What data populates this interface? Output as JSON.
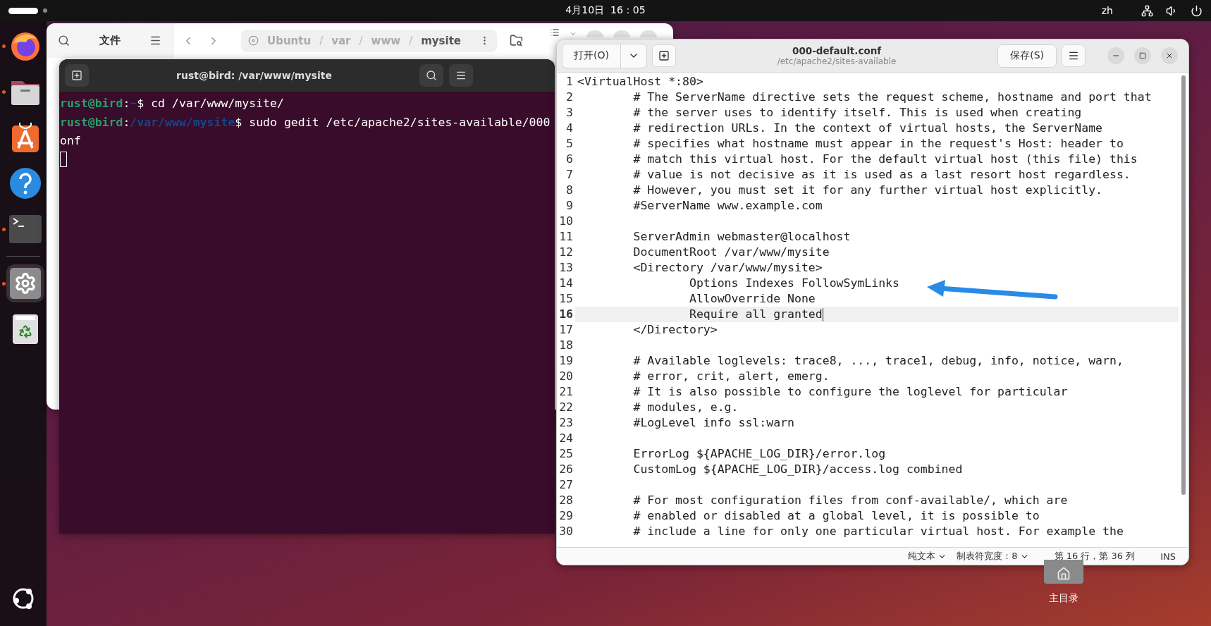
{
  "top_bar": {
    "clock": "4月10日  16：05",
    "language": "zh"
  },
  "dock": {
    "items": [
      {
        "kind": "browser",
        "running": true,
        "selected": false
      },
      {
        "kind": "files",
        "running": true,
        "selected": false
      },
      {
        "kind": "store",
        "running": false,
        "selected": false
      },
      {
        "kind": "help",
        "running": false,
        "selected": false
      },
      {
        "kind": "terminal",
        "running": true,
        "selected": false
      },
      {
        "kind": "separator"
      },
      {
        "kind": "settings",
        "running": true,
        "selected": true
      },
      {
        "kind": "trash",
        "running": false,
        "selected": false
      }
    ]
  },
  "files_window": {
    "sidebar_title": "文件",
    "path_separator": "/",
    "path": [
      "Ubuntu",
      "var",
      "www",
      "mysite"
    ]
  },
  "terminal": {
    "title": "rust@bird: /var/www/mysite",
    "lines": [
      {
        "kind": "prompt",
        "user": "rust@bird",
        "separator": ":",
        "path": "~",
        "symbol": "$",
        "command": " cd /var/www/mysite/"
      },
      {
        "kind": "prompt",
        "user": "rust@bird",
        "separator": ":",
        "path": "/var/www/mysite",
        "symbol": "$",
        "command": " sudo gedit /etc/apache2/sites-available/000"
      },
      {
        "kind": "output",
        "text": "onf"
      }
    ]
  },
  "editor": {
    "open_button": "打开(O)",
    "title": "000-default.conf",
    "subtitle": "/etc/apache2/sites-available",
    "save_button": "保存(S)",
    "lines": [
      {
        "number": "1",
        "text": "<VirtualHost *:80>",
        "current": false
      },
      {
        "number": "2",
        "text": "\t# The ServerName directive sets the request scheme, hostname and port that",
        "current": false
      },
      {
        "number": "3",
        "text": "\t# the server uses to identify itself. This is used when creating",
        "current": false
      },
      {
        "number": "4",
        "text": "\t# redirection URLs. In the context of virtual hosts, the ServerName",
        "current": false
      },
      {
        "number": "5",
        "text": "\t# specifies what hostname must appear in the request's Host: header to",
        "current": false
      },
      {
        "number": "6",
        "text": "\t# match this virtual host. For the default virtual host (this file) this",
        "current": false
      },
      {
        "number": "7",
        "text": "\t# value is not decisive as it is used as a last resort host regardless.",
        "current": false
      },
      {
        "number": "8",
        "text": "\t# However, you must set it for any further virtual host explicitly.",
        "current": false
      },
      {
        "number": "9",
        "text": "\t#ServerName www.example.com",
        "current": false
      },
      {
        "number": "10",
        "current": false
      },
      {
        "number": "11",
        "text": "\tServerAdmin webmaster@localhost",
        "current": false
      },
      {
        "number": "12",
        "text": "\tDocumentRoot /var/www/mysite",
        "current": false
      },
      {
        "number": "13",
        "text": "\t<Directory /var/www/mysite>",
        "current": false
      },
      {
        "number": "14",
        "text": "\t\tOptions Indexes FollowSymLinks",
        "current": false
      },
      {
        "number": "15",
        "text": "\t\tAllowOverride None",
        "current": false
      },
      {
        "number": "16",
        "text": "\t\tRequire all granted",
        "current": true
      },
      {
        "number": "17",
        "text": "\t</Directory>",
        "current": false
      },
      {
        "number": "18",
        "current": false
      },
      {
        "number": "19",
        "text": "\t# Available loglevels: trace8, ..., trace1, debug, info, notice, warn,",
        "current": false
      },
      {
        "number": "20",
        "text": "\t# error, crit, alert, emerg.",
        "current": false
      },
      {
        "number": "21",
        "text": "\t# It is also possible to configure the loglevel for particular",
        "current": false
      },
      {
        "number": "22",
        "text": "\t# modules, e.g.",
        "current": false
      },
      {
        "number": "23",
        "text": "\t#LogLevel info ssl:warn",
        "current": false
      },
      {
        "number": "24",
        "current": false
      },
      {
        "number": "25",
        "text": "\tErrorLog ${APACHE_LOG_DIR}/error.log",
        "current": false
      },
      {
        "number": "26",
        "text": "\tCustomLog ${APACHE_LOG_DIR}/access.log combined",
        "current": false
      },
      {
        "number": "27",
        "current": false
      },
      {
        "number": "28",
        "text": "\t# For most configuration files from conf-available/, which are",
        "current": false
      },
      {
        "number": "29",
        "text": "\t# enabled or disabled at a global level, it is possible to",
        "current": false
      },
      {
        "number": "30",
        "text": "\t# include a line for only one particular virtual host. For example the",
        "current": false
      }
    ],
    "status": {
      "language": "纯文本",
      "tab_width": "制表符宽度：8",
      "position": "第 16 行，第 36 列",
      "mode": "INS"
    }
  },
  "desktop_icon": {
    "label": "主目录"
  }
}
